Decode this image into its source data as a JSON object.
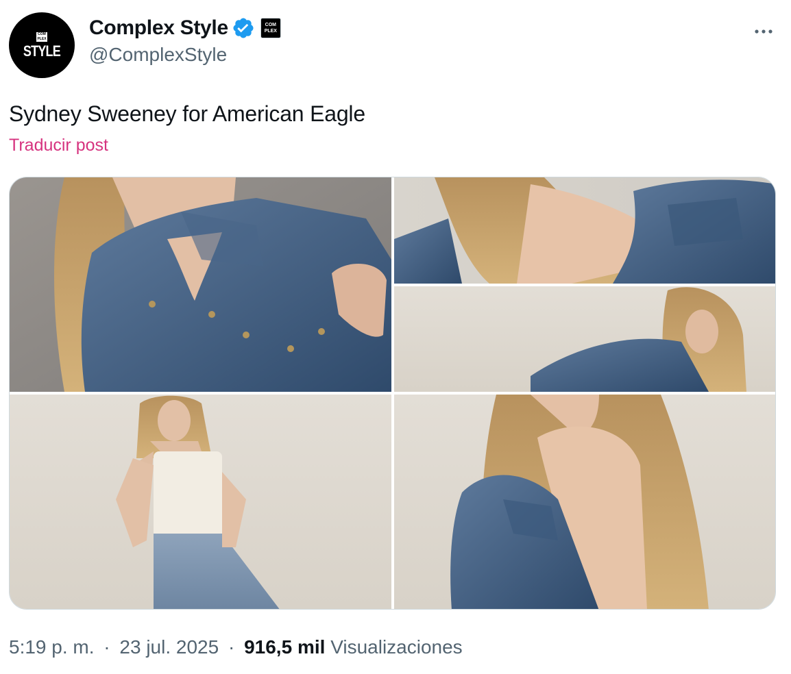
{
  "account": {
    "display_name": "Complex Style",
    "handle": "@ComplexStyle",
    "avatar_badge": "COM PLEX",
    "avatar_word": "STYLE",
    "affiliate_badge": "COM PLEX",
    "verified_color": "#1d9bf0"
  },
  "tweet": {
    "text": "Sydney Sweeney for American Eagle",
    "translate_label": "Traducir post",
    "translate_color": "#d6337f"
  },
  "meta": {
    "time": "5:19 p. m.",
    "separator": "·",
    "date": "23 jul. 2025",
    "views_count": "916,5 mil",
    "views_label": "Visualizaciones"
  },
  "media": {
    "photos": [
      {
        "id": "photo-1",
        "desc": "denim jacket close-up"
      },
      {
        "id": "photo-2",
        "desc": "reclining in denim jacket, back"
      },
      {
        "id": "photo-3",
        "desc": "reclining in denim jacket"
      },
      {
        "id": "photo-4",
        "desc": "white tank top and jeans"
      },
      {
        "id": "photo-5",
        "desc": "bare back with denim jacket"
      }
    ]
  },
  "icons": {
    "more": "more-horizontal-icon",
    "verified": "verified-badge-icon"
  }
}
